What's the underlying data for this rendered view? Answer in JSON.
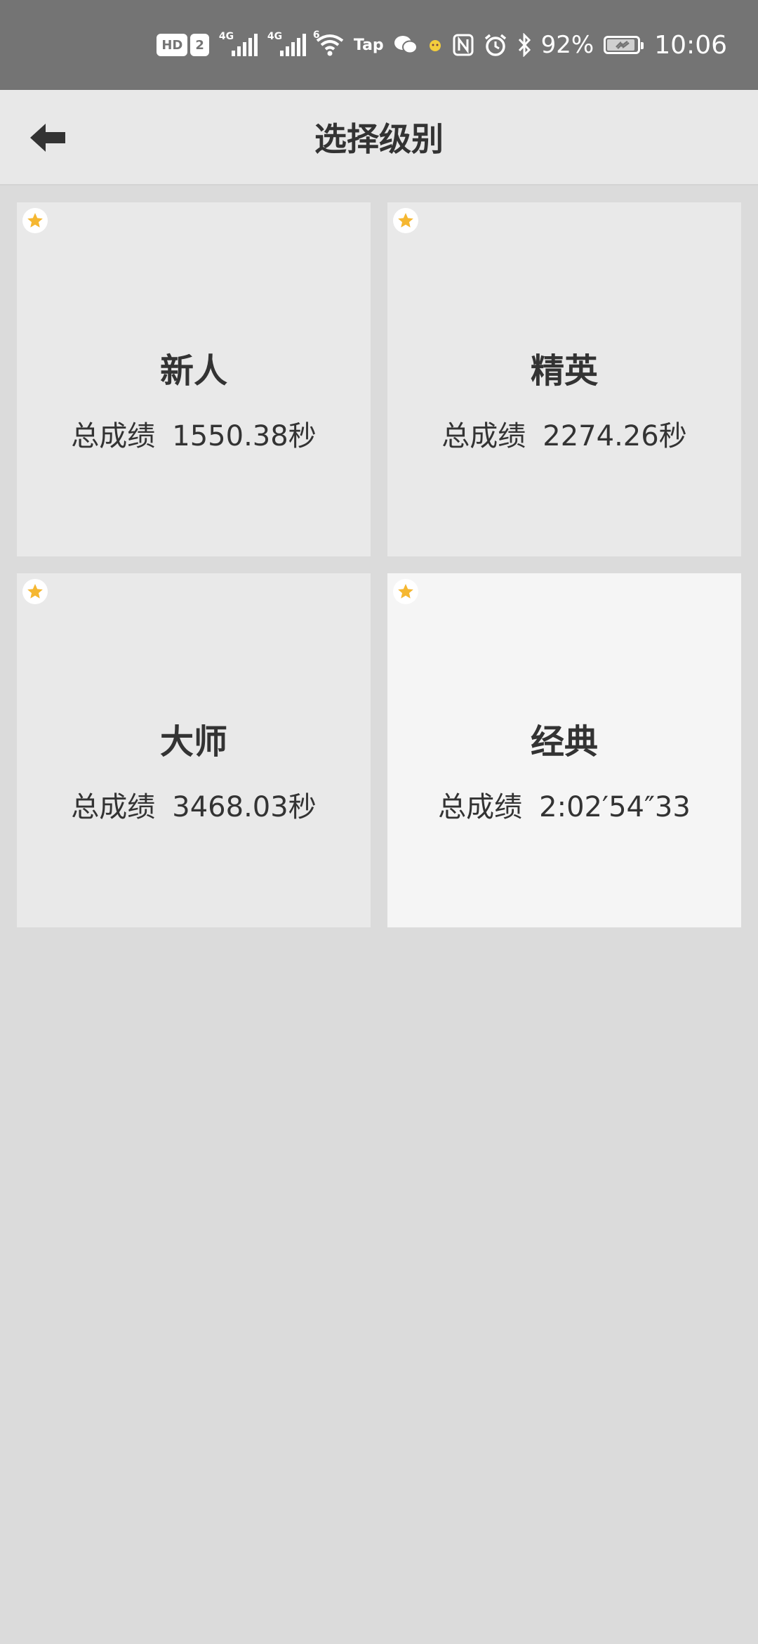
{
  "status_bar": {
    "badges": [
      "HD",
      "2"
    ],
    "network_1": "4G",
    "network_2": "4G",
    "wifi_tag": "6",
    "app_tag": "Tap",
    "battery_percent": "92%",
    "battery_level": 0.92,
    "time": "10:06"
  },
  "header": {
    "title": "选择级别",
    "back_icon": "arrow-left-icon"
  },
  "colors": {
    "star": "#f5b731",
    "card": "#e9e9e9",
    "card_selected": "#f5f5f5",
    "background": "#dbdbdb",
    "status_bar": "#747474"
  },
  "levels": [
    {
      "name": "新人",
      "score_label": "总成绩",
      "score": "1550.38秒",
      "selected": false
    },
    {
      "name": "精英",
      "score_label": "总成绩",
      "score": "2274.26秒",
      "selected": false
    },
    {
      "name": "大师",
      "score_label": "总成绩",
      "score": "3468.03秒",
      "selected": false
    },
    {
      "name": "经典",
      "score_label": "总成绩",
      "score": "2:02′54″33",
      "selected": true
    }
  ]
}
